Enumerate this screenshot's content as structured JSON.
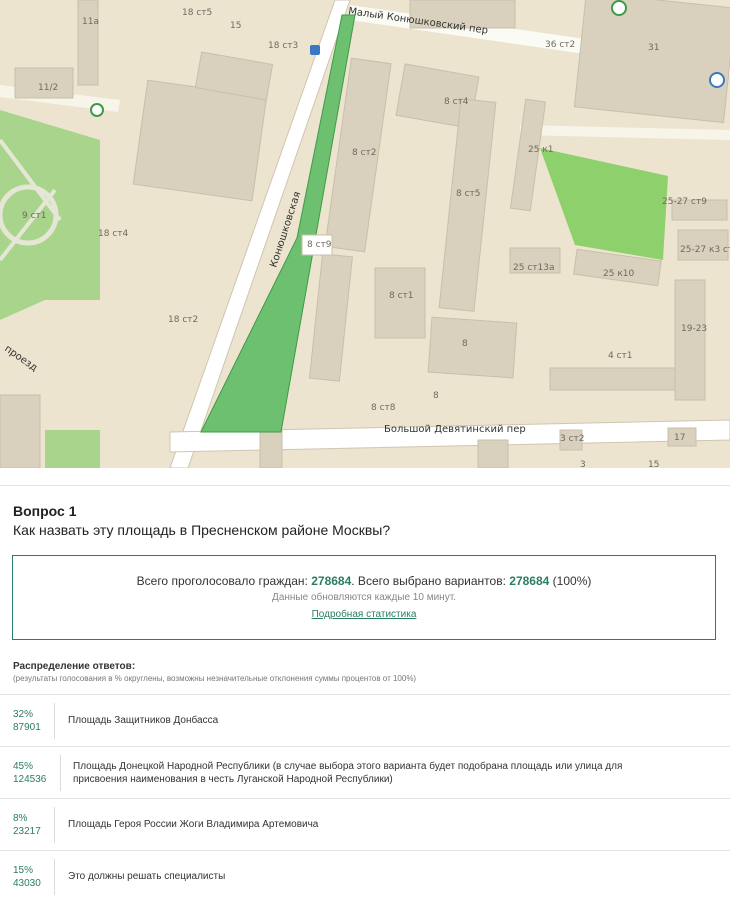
{
  "map": {
    "streets": {
      "maly_konyushkovsky": "Малый Конюшковский пер",
      "konyushkovskaya": "Конюшковская",
      "bolshoy_devyatinsky": "Большой Девятинский пер",
      "proezd": "проезд"
    },
    "buildings": [
      "18 ст5",
      "15",
      "18 ст3",
      "11а",
      "11/2",
      "8 ст4",
      "36 ст2",
      "31",
      "25 к1",
      "9 ст1",
      "18 ст4",
      "8 ст2",
      "8 ст5",
      "8 ст9",
      "25-27 ст9",
      "25-27 к3 ст",
      "25 ст13а",
      "25 к10",
      "8 ст1",
      "18 ст2",
      "19-23",
      "8",
      "4 ст1",
      "8",
      "8 ст8",
      "3 ст2",
      "17",
      "3",
      "15"
    ],
    "area_color": "#6cc070"
  },
  "question": {
    "title": "Вопрос 1",
    "text": "Как назвать эту площадь в Пресненском районе Москвы?"
  },
  "stats": {
    "voted_label": "Всего проголосовало граждан:",
    "voted_value": "278684",
    "options_label": ". Всего выбрано вариантов:",
    "options_value": "278684",
    "options_pct": "(100%)",
    "update_note": "Данные обновляются каждые 10 минут.",
    "detail_link": "Подробная статистика"
  },
  "distribution": {
    "title": "Распределение ответов:",
    "note": "(результаты голосования в % округлены, возможны незначительные отклонения суммы процентов от 100%)",
    "answers": [
      {
        "pct": "32%",
        "count": "87901",
        "label": "Площадь Защитников Донбасса"
      },
      {
        "pct": "45%",
        "count": "124536",
        "label": "Площадь Донецкой Народной Республики (в случае выбора этого варианта будет подобрана площадь или улица для присвоения наименования в честь Луганской Народной Республики)"
      },
      {
        "pct": "8%",
        "count": "23217",
        "label": "Площадь Героя России Жоги Владимира Артемовича"
      },
      {
        "pct": "15%",
        "count": "43030",
        "label": "Это должны решать специалисты"
      }
    ]
  }
}
